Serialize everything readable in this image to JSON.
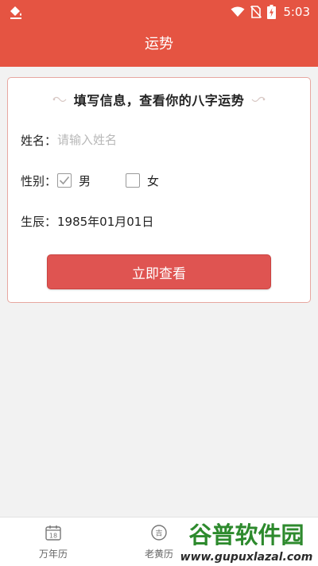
{
  "status_bar": {
    "time": "5:03"
  },
  "header": {
    "title": "运势"
  },
  "card": {
    "heading": "填写信息，查看你的八字运势",
    "name_label": "姓名：",
    "name_placeholder": "请输入姓名",
    "name_value": "",
    "gender_label": "性别：",
    "gender_options": [
      {
        "label": "男",
        "checked": true
      },
      {
        "label": "女",
        "checked": false
      }
    ],
    "birth_label": "生辰：",
    "birth_value": "1985年01月01日",
    "submit_label": "立即查看"
  },
  "bottom_nav": {
    "items": [
      {
        "label": "万年历",
        "icon": "calendar-icon",
        "icon_text": "18"
      },
      {
        "label": "老黄历",
        "icon": "almanac-icon",
        "icon_text": "吉"
      }
    ]
  },
  "watermark": {
    "brand": "谷普软件园",
    "url": "www.gupuxlazal.com"
  },
  "colors": {
    "primary": "#e55442",
    "button": "#df5451",
    "card_border": "#e7a7a0",
    "background": "#f2f2f2"
  }
}
